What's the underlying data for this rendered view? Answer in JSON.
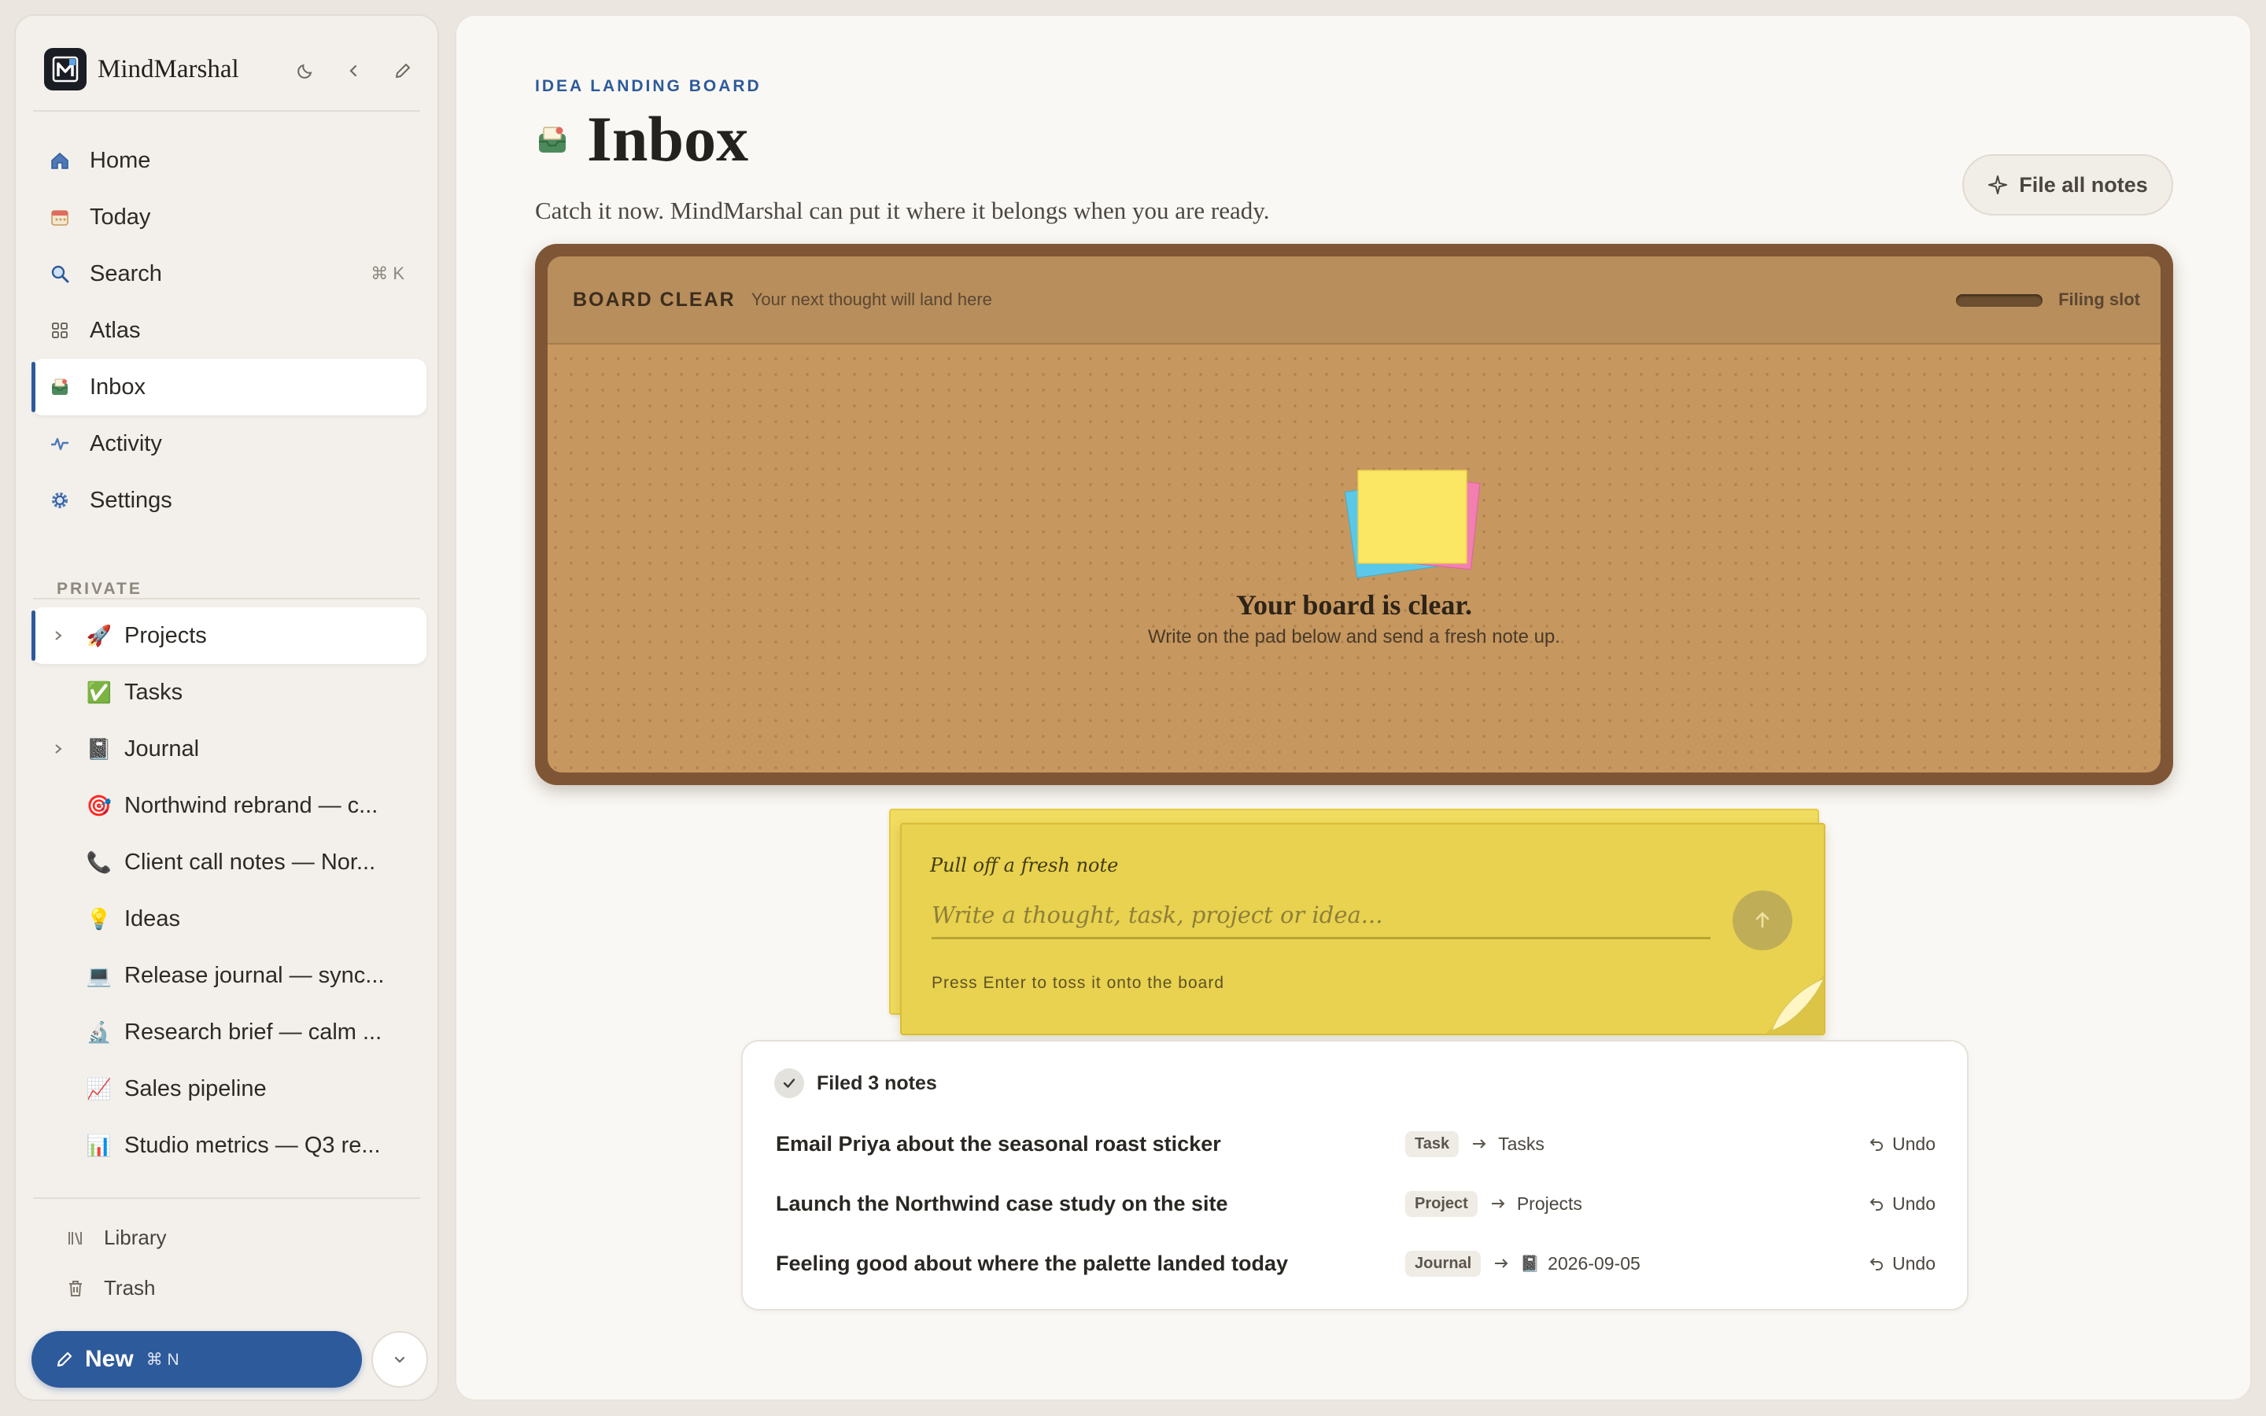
{
  "app": {
    "name": "MindMarshal"
  },
  "sidebar": {
    "nav": [
      {
        "label": "Home",
        "icon": "home-icon"
      },
      {
        "label": "Today",
        "icon": "calendar-icon"
      },
      {
        "label": "Search",
        "icon": "search-icon",
        "shortcut": "⌘ K"
      },
      {
        "label": "Atlas",
        "icon": "grid-icon"
      },
      {
        "label": "Inbox",
        "icon": "inbox-icon",
        "active": true
      },
      {
        "label": "Activity",
        "icon": "activity-icon"
      },
      {
        "label": "Settings",
        "icon": "gear-icon"
      }
    ],
    "section_label": "PRIVATE",
    "pages": [
      {
        "label": "Projects",
        "emoji": "🚀",
        "expandable": true,
        "active": true
      },
      {
        "label": "Tasks",
        "emoji": "✅"
      },
      {
        "label": "Journal",
        "emoji": "📓",
        "expandable": true
      },
      {
        "label": "Northwind rebrand — c...",
        "emoji": "🎯"
      },
      {
        "label": "Client call notes — Nor...",
        "emoji": "📞"
      },
      {
        "label": "Ideas",
        "emoji": "💡"
      },
      {
        "label": "Release journal — sync...",
        "emoji": "💻"
      },
      {
        "label": "Research brief — calm ...",
        "emoji": "🔬"
      },
      {
        "label": "Sales pipeline",
        "emoji": "📈"
      },
      {
        "label": "Studio metrics — Q3 re...",
        "emoji": "📊"
      }
    ],
    "footer": [
      {
        "label": "Library",
        "icon": "library-icon"
      },
      {
        "label": "Trash",
        "icon": "trash-icon"
      }
    ],
    "new_button": {
      "label": "New",
      "shortcut": "⌘ N"
    }
  },
  "main": {
    "eyebrow": "IDEA LANDING BOARD",
    "title": "Inbox",
    "subtitle": "Catch it now. MindMarshal can put it where it belongs when you are ready.",
    "file_all_label": "File all notes",
    "board": {
      "status": "BOARD CLEAR",
      "hint": "Your next thought will land here",
      "slot_label": "Filing slot",
      "empty_title": "Your board is clear.",
      "empty_sub": "Write on the pad below and send a fresh note up."
    },
    "pad": {
      "label": "Pull off a fresh note",
      "placeholder": "Write a thought, task, project or idea...",
      "hint": "Press Enter to toss it onto the board"
    },
    "filed": {
      "heading": "Filed 3 notes",
      "rows": [
        {
          "text": "Email Priya about the seasonal roast sticker",
          "type": "Task",
          "dest": "Tasks",
          "undo": "Undo"
        },
        {
          "text": "Launch the Northwind case study on the site",
          "type": "Project",
          "dest": "Projects",
          "undo": "Undo"
        },
        {
          "text": "Feeling good about where the palette landed today",
          "type": "Journal",
          "dest": "2026-09-05",
          "dest_icon": "📓",
          "undo": "Undo"
        }
      ]
    }
  },
  "colors": {
    "accent": "#2d5a9a",
    "board_frame": "#7e5636",
    "cork": "#c6975f",
    "pad": "#e8d24f"
  }
}
